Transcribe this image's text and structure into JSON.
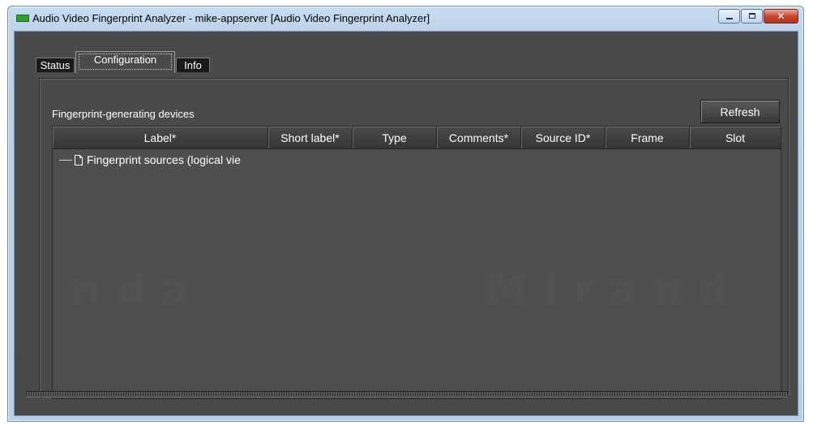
{
  "window": {
    "title": "Audio Video Fingerprint Analyzer - mike-appserver [Audio Video Fingerprint Analyzer]",
    "icon": "green-app-icon",
    "controls": {
      "minimize_icon": "minimize-icon",
      "maximize_icon": "maximize-icon",
      "close_label": "✕"
    }
  },
  "tabs": [
    {
      "label": "Status",
      "active": false
    },
    {
      "label": "Configuration",
      "active": true
    },
    {
      "label": "Info",
      "active": false
    }
  ],
  "panel": {
    "section_label": "Fingerprint-generating devices",
    "refresh_label": "Refresh"
  },
  "table": {
    "columns": [
      "Label*",
      "Short label*",
      "Type",
      "Comments*",
      "Source ID*",
      "Frame",
      "Slot"
    ],
    "tree_root": "Fingerprint sources (logical vie"
  },
  "watermark": {
    "left_text": "nda",
    "right_text": "Mirand"
  },
  "colors": {
    "background": "#4a4a4a",
    "header": "#3c3c3c",
    "text": "#ffffff",
    "titlebar": "#bcd3ea",
    "close": "#c7462f"
  }
}
